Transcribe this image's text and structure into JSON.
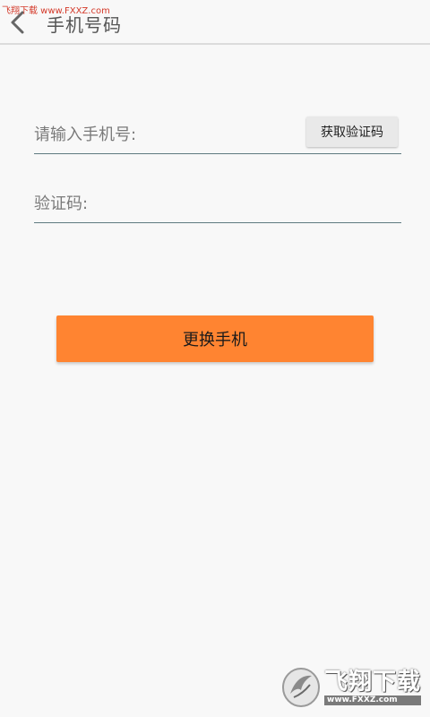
{
  "watermark": {
    "top_left_text": "飞翔下载 www.FXXZ.com",
    "logo_text": "飞翔下载",
    "logo_url": "www.FXXZ.com"
  },
  "header": {
    "title": "手机号码"
  },
  "form": {
    "phone_placeholder": "请输入手机号:",
    "phone_value": "",
    "get_code_label": "获取验证码",
    "code_placeholder": "验证码:",
    "code_value": ""
  },
  "actions": {
    "submit_label": "更换手机"
  },
  "colors": {
    "primary_button": "#ff8431",
    "background": "#f8f8f8",
    "underline": "#5f7a80"
  },
  "icons": {
    "back": "chevron-left-icon"
  }
}
